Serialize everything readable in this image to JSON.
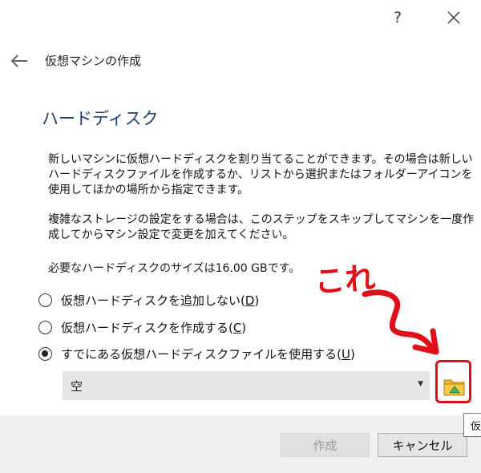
{
  "window": {
    "title": "仮想マシンの作成",
    "help_symbol": "?"
  },
  "page": {
    "section_title": "ハードディスク",
    "description_1": "新しいマシンに仮想ハードディスクを割り当てることができます。その場合は新しいハードディスクファイルを作成するか、リストから選択またはフォルダーアイコンを使用してほかの場所から指定できます。",
    "description_2": "複雑なストレージの設定をする場合は、このステップをスキップしてマシンを一度作成してからマシン設定で変更を加えてください。",
    "size_prefix": "必要なハードディスクのサイズは",
    "size_value": "16.00 GB",
    "size_suffix": "です。"
  },
  "options": [
    {
      "label": "仮想ハードディスクを追加しない(",
      "key": "D",
      "close": ")",
      "selected": false
    },
    {
      "label": "仮想ハードディスクを作成する(",
      "key": "C",
      "close": ")",
      "selected": false
    },
    {
      "label": "すでにある仮想ハードディスクファイルを使用する(",
      "key": "U",
      "close": ")",
      "selected": true
    }
  ],
  "disk_select": {
    "value": "空",
    "arrow": "▼"
  },
  "tooltip": {
    "text": "仮"
  },
  "buttons": {
    "create": "作成",
    "cancel": "キャンセル"
  },
  "annotation": {
    "text": "これ",
    "color": "#e0101a"
  },
  "colors": {
    "title_blue": "#1f3f73",
    "footer_bg": "#f0f0f0",
    "select_bg": "#e6e6e6",
    "folder_yellow": "#f2b535",
    "folder_green": "#4caf50"
  }
}
